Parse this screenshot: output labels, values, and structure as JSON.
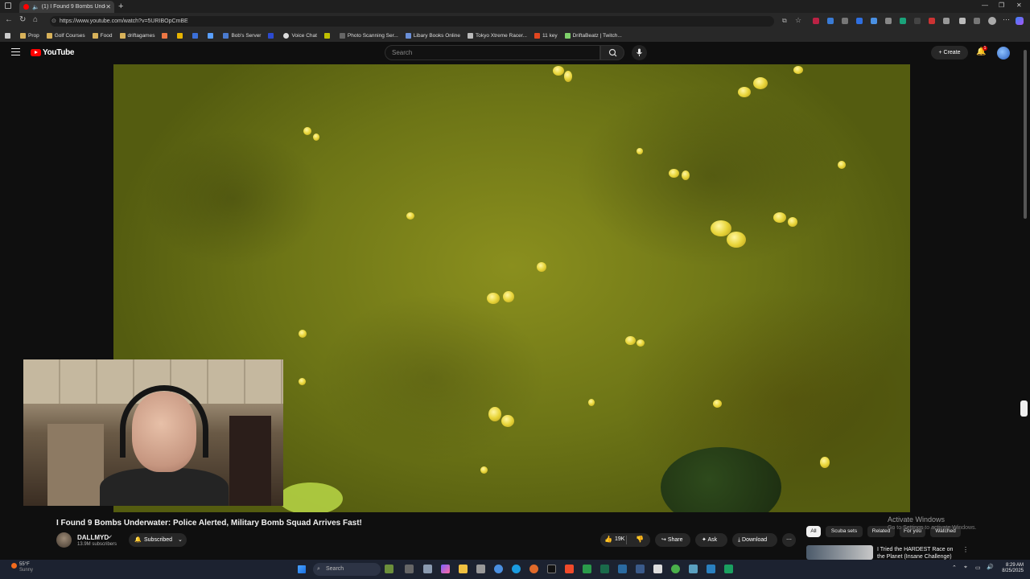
{
  "browser": {
    "tab_title": "(1) I Found 9 Bombs Underw...",
    "url": "https://www.youtube.com/watch?v=5URIBOpCmBE",
    "bookmarks": [
      {
        "label": "Prop"
      },
      {
        "label": "Golf Courses"
      },
      {
        "label": "Food"
      },
      {
        "label": "driftagames"
      },
      {
        "label": "Bob's Server"
      },
      {
        "label": "Voice Chat"
      },
      {
        "label": "Photo Scanning Ser..."
      },
      {
        "label": "Libary Books Online"
      },
      {
        "label": "Tokyo Xtreme Racer..."
      },
      {
        "label": "11 key"
      },
      {
        "label": "DriftaBeatz | Twitch..."
      }
    ]
  },
  "youtube": {
    "logo_text": "YouTube",
    "search_placeholder": "Search",
    "create_label": "Create",
    "notification_count": "1"
  },
  "video": {
    "title": "I Found 9 Bombs Underwater: Police Alerted, Military Bomb Squad Arrives Fast!",
    "channel_name": "DALLMYD",
    "subscribers": "13.9M subscribers",
    "subscribe_label": "Subscribed",
    "likes": "19K",
    "share_label": "Share",
    "ask_label": "Ask",
    "download_label": "Download",
    "more_label": "⋯"
  },
  "chips": [
    {
      "label": "All"
    },
    {
      "label": "Scuba sets"
    },
    {
      "label": "Related"
    },
    {
      "label": "For you"
    },
    {
      "label": "Watched"
    }
  ],
  "recommendation": {
    "title": "I Tried the HARDEST Race on the Planet (Insane Challenge)"
  },
  "watermark": {
    "line1": "Activate Windows",
    "line2": "Go to Settings to activate Windows."
  },
  "taskbar": {
    "weather_temp": "55°F",
    "weather_desc": "Sunny",
    "search_label": "Search",
    "time": "8:29 AM",
    "date": "8/25/2025"
  },
  "colors": {
    "accent_red": "#ff0000",
    "background": "#0f0f0f",
    "button_bg": "#272727"
  }
}
